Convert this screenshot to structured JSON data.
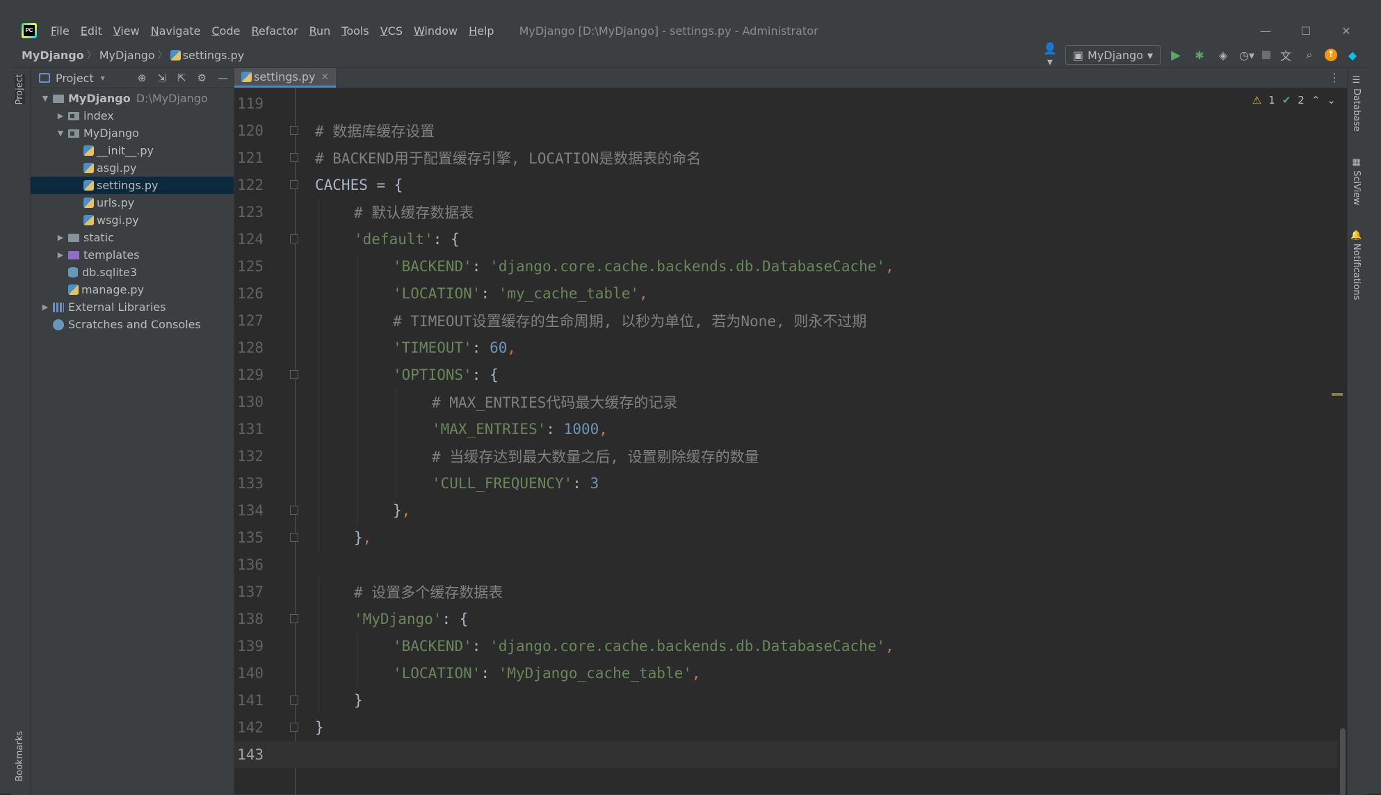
{
  "window": {
    "title": "MyDjango [D:\\MyDjango] - settings.py - Administrator",
    "menu": [
      "File",
      "Edit",
      "View",
      "Navigate",
      "Code",
      "Refactor",
      "Run",
      "Tools",
      "VCS",
      "Window",
      "Help"
    ],
    "controls": {
      "minimize": "—",
      "maximize": "☐",
      "close": "✕"
    }
  },
  "breadcrumb": [
    "MyDjango",
    "MyDjango",
    "settings.py"
  ],
  "toolbar": {
    "run_config": "MyDjango",
    "icons": [
      "user-icon",
      "run-icon",
      "debug-icon",
      "coverage-icon",
      "profile-icon",
      "stop-icon",
      "translate-icon",
      "search-icon",
      "update-icon",
      "plugin-icon"
    ]
  },
  "left_stripe": {
    "project": "Project",
    "bookmarks": "Bookmarks"
  },
  "right_stripe": {
    "database": "Database",
    "sciview": "SciView",
    "notifications": "Notifications"
  },
  "project_panel": {
    "title": "Project",
    "tree": [
      {
        "label": "MyDjango",
        "hint": "D:\\MyDjango",
        "depth": 0,
        "arrow": "down",
        "icon": "folder",
        "bold": true
      },
      {
        "label": "index",
        "depth": 1,
        "arrow": "right",
        "icon": "module-folder"
      },
      {
        "label": "MyDjango",
        "depth": 1,
        "arrow": "down",
        "icon": "module-folder"
      },
      {
        "label": "__init__.py",
        "depth": 2,
        "icon": "python-file"
      },
      {
        "label": "asgi.py",
        "depth": 2,
        "icon": "python-file"
      },
      {
        "label": "settings.py",
        "depth": 2,
        "icon": "python-file",
        "selected": true
      },
      {
        "label": "urls.py",
        "depth": 2,
        "icon": "python-file"
      },
      {
        "label": "wsgi.py",
        "depth": 2,
        "icon": "python-file"
      },
      {
        "label": "static",
        "depth": 1,
        "arrow": "right",
        "icon": "folder"
      },
      {
        "label": "templates",
        "depth": 1,
        "arrow": "right",
        "icon": "templates-folder"
      },
      {
        "label": "db.sqlite3",
        "depth": 1,
        "icon": "database-file"
      },
      {
        "label": "manage.py",
        "depth": 1,
        "icon": "python-file"
      },
      {
        "label": "External Libraries",
        "depth": 0,
        "arrow": "right",
        "icon": "library"
      },
      {
        "label": "Scratches and Consoles",
        "depth": 0,
        "icon": "scratch"
      }
    ]
  },
  "editor": {
    "tab": "settings.py",
    "inspections": {
      "warnings": "1",
      "ok": "2"
    },
    "current_line": 143,
    "lines": [
      {
        "n": 119,
        "tokens": []
      },
      {
        "n": 120,
        "fold": true,
        "tokens": [
          [
            "cmt",
            "# 数据库缓存设置"
          ]
        ]
      },
      {
        "n": 121,
        "fold": true,
        "tokens": [
          [
            "cmt",
            "# BACKEND用于配置缓存引擎, LOCATION是数据表的命名"
          ]
        ]
      },
      {
        "n": 122,
        "fold": true,
        "tokens": [
          [
            "plain",
            "CACHES = {"
          ]
        ]
      },
      {
        "n": 123,
        "indent": 1,
        "tokens": [
          [
            "cmt",
            "# 默认缓存数据表"
          ]
        ]
      },
      {
        "n": 124,
        "fold": true,
        "indent": 1,
        "tokens": [
          [
            "str",
            "'default'"
          ],
          [
            "plain",
            ": {"
          ]
        ]
      },
      {
        "n": 125,
        "indent": 2,
        "tokens": [
          [
            "str",
            "'BACKEND'"
          ],
          [
            "plain",
            ": "
          ],
          [
            "str",
            "'django.core.cache.backends.db.DatabaseCache'"
          ],
          [
            "kw",
            ","
          ]
        ]
      },
      {
        "n": 126,
        "indent": 2,
        "tokens": [
          [
            "str",
            "'LOCATION'"
          ],
          [
            "plain",
            ": "
          ],
          [
            "str",
            "'my_cache_table'"
          ],
          [
            "kw",
            ","
          ]
        ]
      },
      {
        "n": 127,
        "indent": 2,
        "tokens": [
          [
            "cmt",
            "# TIMEOUT设置缓存的生命周期, 以秒为单位, 若为None, 则永不过期"
          ]
        ]
      },
      {
        "n": 128,
        "indent": 2,
        "tokens": [
          [
            "str",
            "'TIMEOUT'"
          ],
          [
            "plain",
            ": "
          ],
          [
            "num",
            "60"
          ],
          [
            "kw",
            ","
          ]
        ]
      },
      {
        "n": 129,
        "fold": true,
        "indent": 2,
        "tokens": [
          [
            "str",
            "'OPTIONS'"
          ],
          [
            "plain",
            ": {"
          ]
        ]
      },
      {
        "n": 130,
        "indent": 3,
        "tokens": [
          [
            "cmt",
            "# MAX_ENTRIES代码最大缓存的记录"
          ]
        ]
      },
      {
        "n": 131,
        "indent": 3,
        "tokens": [
          [
            "str",
            "'MAX_ENTRIES'"
          ],
          [
            "plain",
            ": "
          ],
          [
            "num",
            "1000"
          ],
          [
            "kw",
            ","
          ]
        ]
      },
      {
        "n": 132,
        "indent": 3,
        "tokens": [
          [
            "cmt",
            "# 当缓存达到最大数量之后, 设置剔除缓存的数量"
          ]
        ]
      },
      {
        "n": 133,
        "indent": 3,
        "tokens": [
          [
            "str",
            "'CULL_FREQUENCY'"
          ],
          [
            "plain",
            ": "
          ],
          [
            "num",
            "3"
          ]
        ]
      },
      {
        "n": 134,
        "fold": true,
        "indent": 2,
        "tokens": [
          [
            "plain",
            "}"
          ],
          [
            "kw",
            ","
          ]
        ]
      },
      {
        "n": 135,
        "fold": true,
        "indent": 1,
        "tokens": [
          [
            "plain",
            "}"
          ],
          [
            "kw",
            ","
          ]
        ]
      },
      {
        "n": 136,
        "tokens": []
      },
      {
        "n": 137,
        "indent": 1,
        "tokens": [
          [
            "cmt",
            "# 设置多个缓存数据表"
          ]
        ]
      },
      {
        "n": 138,
        "fold": true,
        "indent": 1,
        "tokens": [
          [
            "str",
            "'MyDjango'"
          ],
          [
            "plain",
            ": {"
          ]
        ]
      },
      {
        "n": 139,
        "indent": 2,
        "tokens": [
          [
            "str",
            "'BACKEND'"
          ],
          [
            "plain",
            ": "
          ],
          [
            "str",
            "'django.core.cache.backends.db.DatabaseCache'"
          ],
          [
            "kw",
            ","
          ]
        ]
      },
      {
        "n": 140,
        "indent": 2,
        "tokens": [
          [
            "str",
            "'LOCATION'"
          ],
          [
            "plain",
            ": "
          ],
          [
            "str",
            "'MyDjango_cache_table'"
          ],
          [
            "kw",
            ","
          ]
        ]
      },
      {
        "n": 141,
        "fold": true,
        "indent": 1,
        "tokens": [
          [
            "plain",
            "}"
          ]
        ]
      },
      {
        "n": 142,
        "fold": true,
        "tokens": [
          [
            "plain",
            "}"
          ]
        ]
      },
      {
        "n": 143,
        "tokens": []
      }
    ]
  }
}
